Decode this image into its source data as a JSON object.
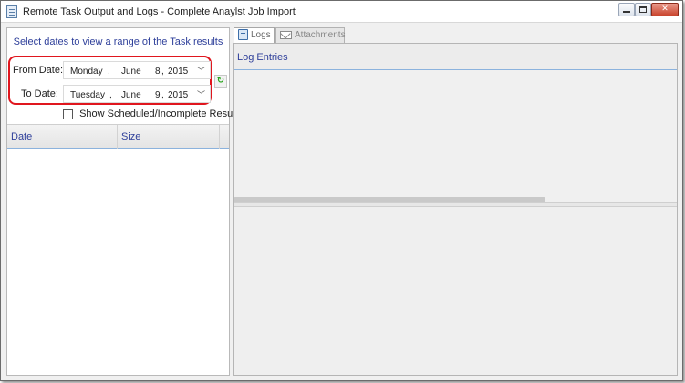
{
  "window": {
    "title": "Remote Task Output and Logs - Complete Anaylst Job Import",
    "controls": {
      "minimize": "minimize-icon",
      "maximize": "maximize-icon",
      "close": "✕"
    }
  },
  "filter": {
    "instruction": "Select dates to view a range of the Task results",
    "from_label": "From Date:",
    "from": {
      "weekday": "Monday",
      "month": "June",
      "day": "8",
      "year": "2015"
    },
    "to_label": "To Date:",
    "to": {
      "weekday": "Tuesday",
      "month": "June",
      "day": "9",
      "year": "2015"
    },
    "separator": ",",
    "dropdown_arrow": "﹀",
    "refresh_icon": "↻",
    "show_scheduled_label": "Show Scheduled/Incomplete Results",
    "show_scheduled_checked": false,
    "highlight_color": "#e0161e"
  },
  "results_grid": {
    "columns": [
      "Date",
      "Size"
    ],
    "rows": []
  },
  "tabs": [
    {
      "label": "Logs",
      "icon": "document-icon",
      "active": true
    },
    {
      "label": "Attachments",
      "icon": "envelope-icon",
      "active": false
    }
  ],
  "logs": {
    "header": "Log Entries",
    "entries": []
  },
  "colors": {
    "header_text": "#2e3f9a",
    "grid_rule": "#8bb2dd"
  }
}
